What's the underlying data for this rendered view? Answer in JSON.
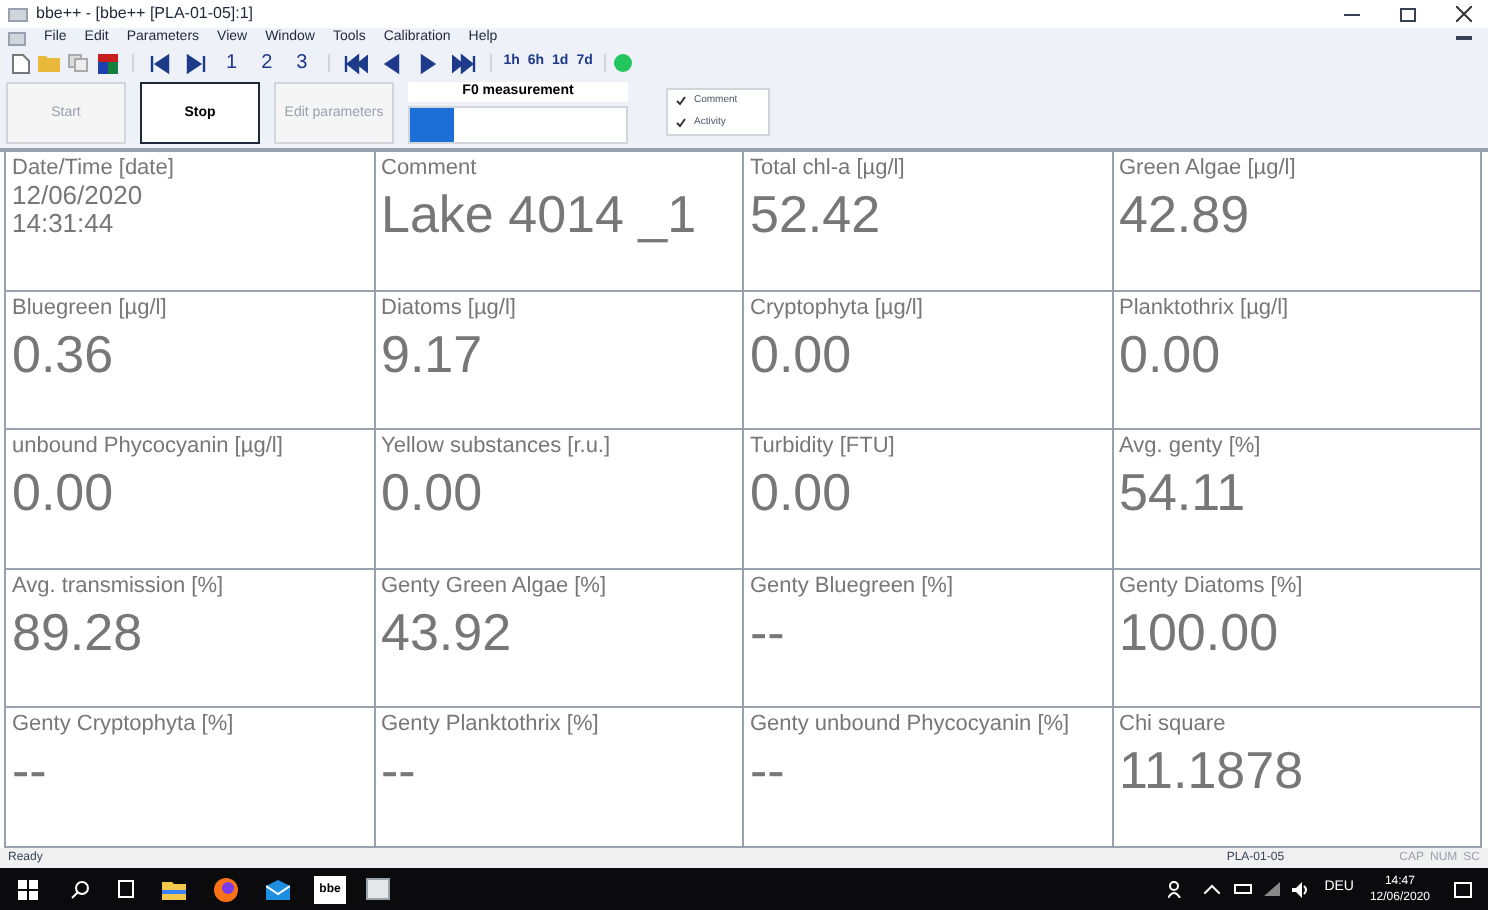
{
  "window": {
    "title": "bbe++ - [bbe++ [PLA-01-05]:1]"
  },
  "menu": [
    "File",
    "Edit",
    "Parameters",
    "View",
    "Window",
    "Tools",
    "Calibration",
    "Help"
  ],
  "toolbar": {
    "pages": [
      "1",
      "2",
      "3"
    ],
    "ranges": [
      "1h",
      "6h",
      "1d",
      "7d"
    ],
    "status_on": true
  },
  "controls": {
    "buttons": [
      {
        "label": "Start",
        "disabled": true
      },
      {
        "label": "Stop",
        "disabled": false
      },
      {
        "label": "Edit parameters",
        "disabled": true
      }
    ],
    "progress": {
      "title": "F0 measurement",
      "level": 0.2
    },
    "checks": [
      {
        "label": "Comment",
        "checked": true
      },
      {
        "label": "Activity",
        "checked": true
      }
    ]
  },
  "cells": [
    {
      "label": "Date/Time [date]",
      "kind": "lines",
      "lines": [
        "12/06/2020",
        "14:31:44"
      ]
    },
    {
      "label": "Comment",
      "kind": "value",
      "value": "Lake 4014 _1"
    },
    {
      "label": "Total chl-a [µg/l]",
      "kind": "value",
      "value": "52.42"
    },
    {
      "label": "Green Algae [µg/l]",
      "kind": "value",
      "value": "42.89"
    },
    {
      "label": "Bluegreen [µg/l]",
      "kind": "value",
      "value": "0.36"
    },
    {
      "label": "Diatoms [µg/l]",
      "kind": "value",
      "value": "9.17"
    },
    {
      "label": "Cryptophyta [µg/l]",
      "kind": "value",
      "value": "0.00"
    },
    {
      "label": "Planktothrix [µg/l]",
      "kind": "value",
      "value": "0.00"
    },
    {
      "label": "unbound Phycocyanin [µg/l]",
      "kind": "value",
      "value": "0.00"
    },
    {
      "label": "Yellow substances [r.u.]",
      "kind": "value",
      "value": "0.00"
    },
    {
      "label": "Turbidity [FTU]",
      "kind": "value",
      "value": "0.00"
    },
    {
      "label": "Avg. genty [%]",
      "kind": "value",
      "value": "54.11"
    },
    {
      "label": "Avg. transmission [%]",
      "kind": "value",
      "value": "89.28"
    },
    {
      "label": "Genty Green Algae [%]",
      "kind": "value",
      "value": "43.92"
    },
    {
      "label": "Genty Bluegreen [%]",
      "kind": "value",
      "value": "--"
    },
    {
      "label": "Genty Diatoms [%]",
      "kind": "value",
      "value": "100.00"
    },
    {
      "label": "Genty Cryptophyta [%]",
      "kind": "value",
      "value": "--"
    },
    {
      "label": "Genty Planktothrix [%]",
      "kind": "value",
      "value": "--"
    },
    {
      "label": "Genty unbound Phycocyanin [%]",
      "kind": "value",
      "value": "--"
    },
    {
      "label": "Chi square",
      "kind": "value",
      "value": "11.1878"
    }
  ],
  "status_bar": {
    "left": "Ready",
    "device": "PLA-01-05",
    "indicators": [
      "CAP",
      "NUM",
      "SC"
    ]
  },
  "taskbar": {
    "app_label": "bbe",
    "language": "DEU",
    "time": "14:47",
    "date": "12/06/2020"
  }
}
